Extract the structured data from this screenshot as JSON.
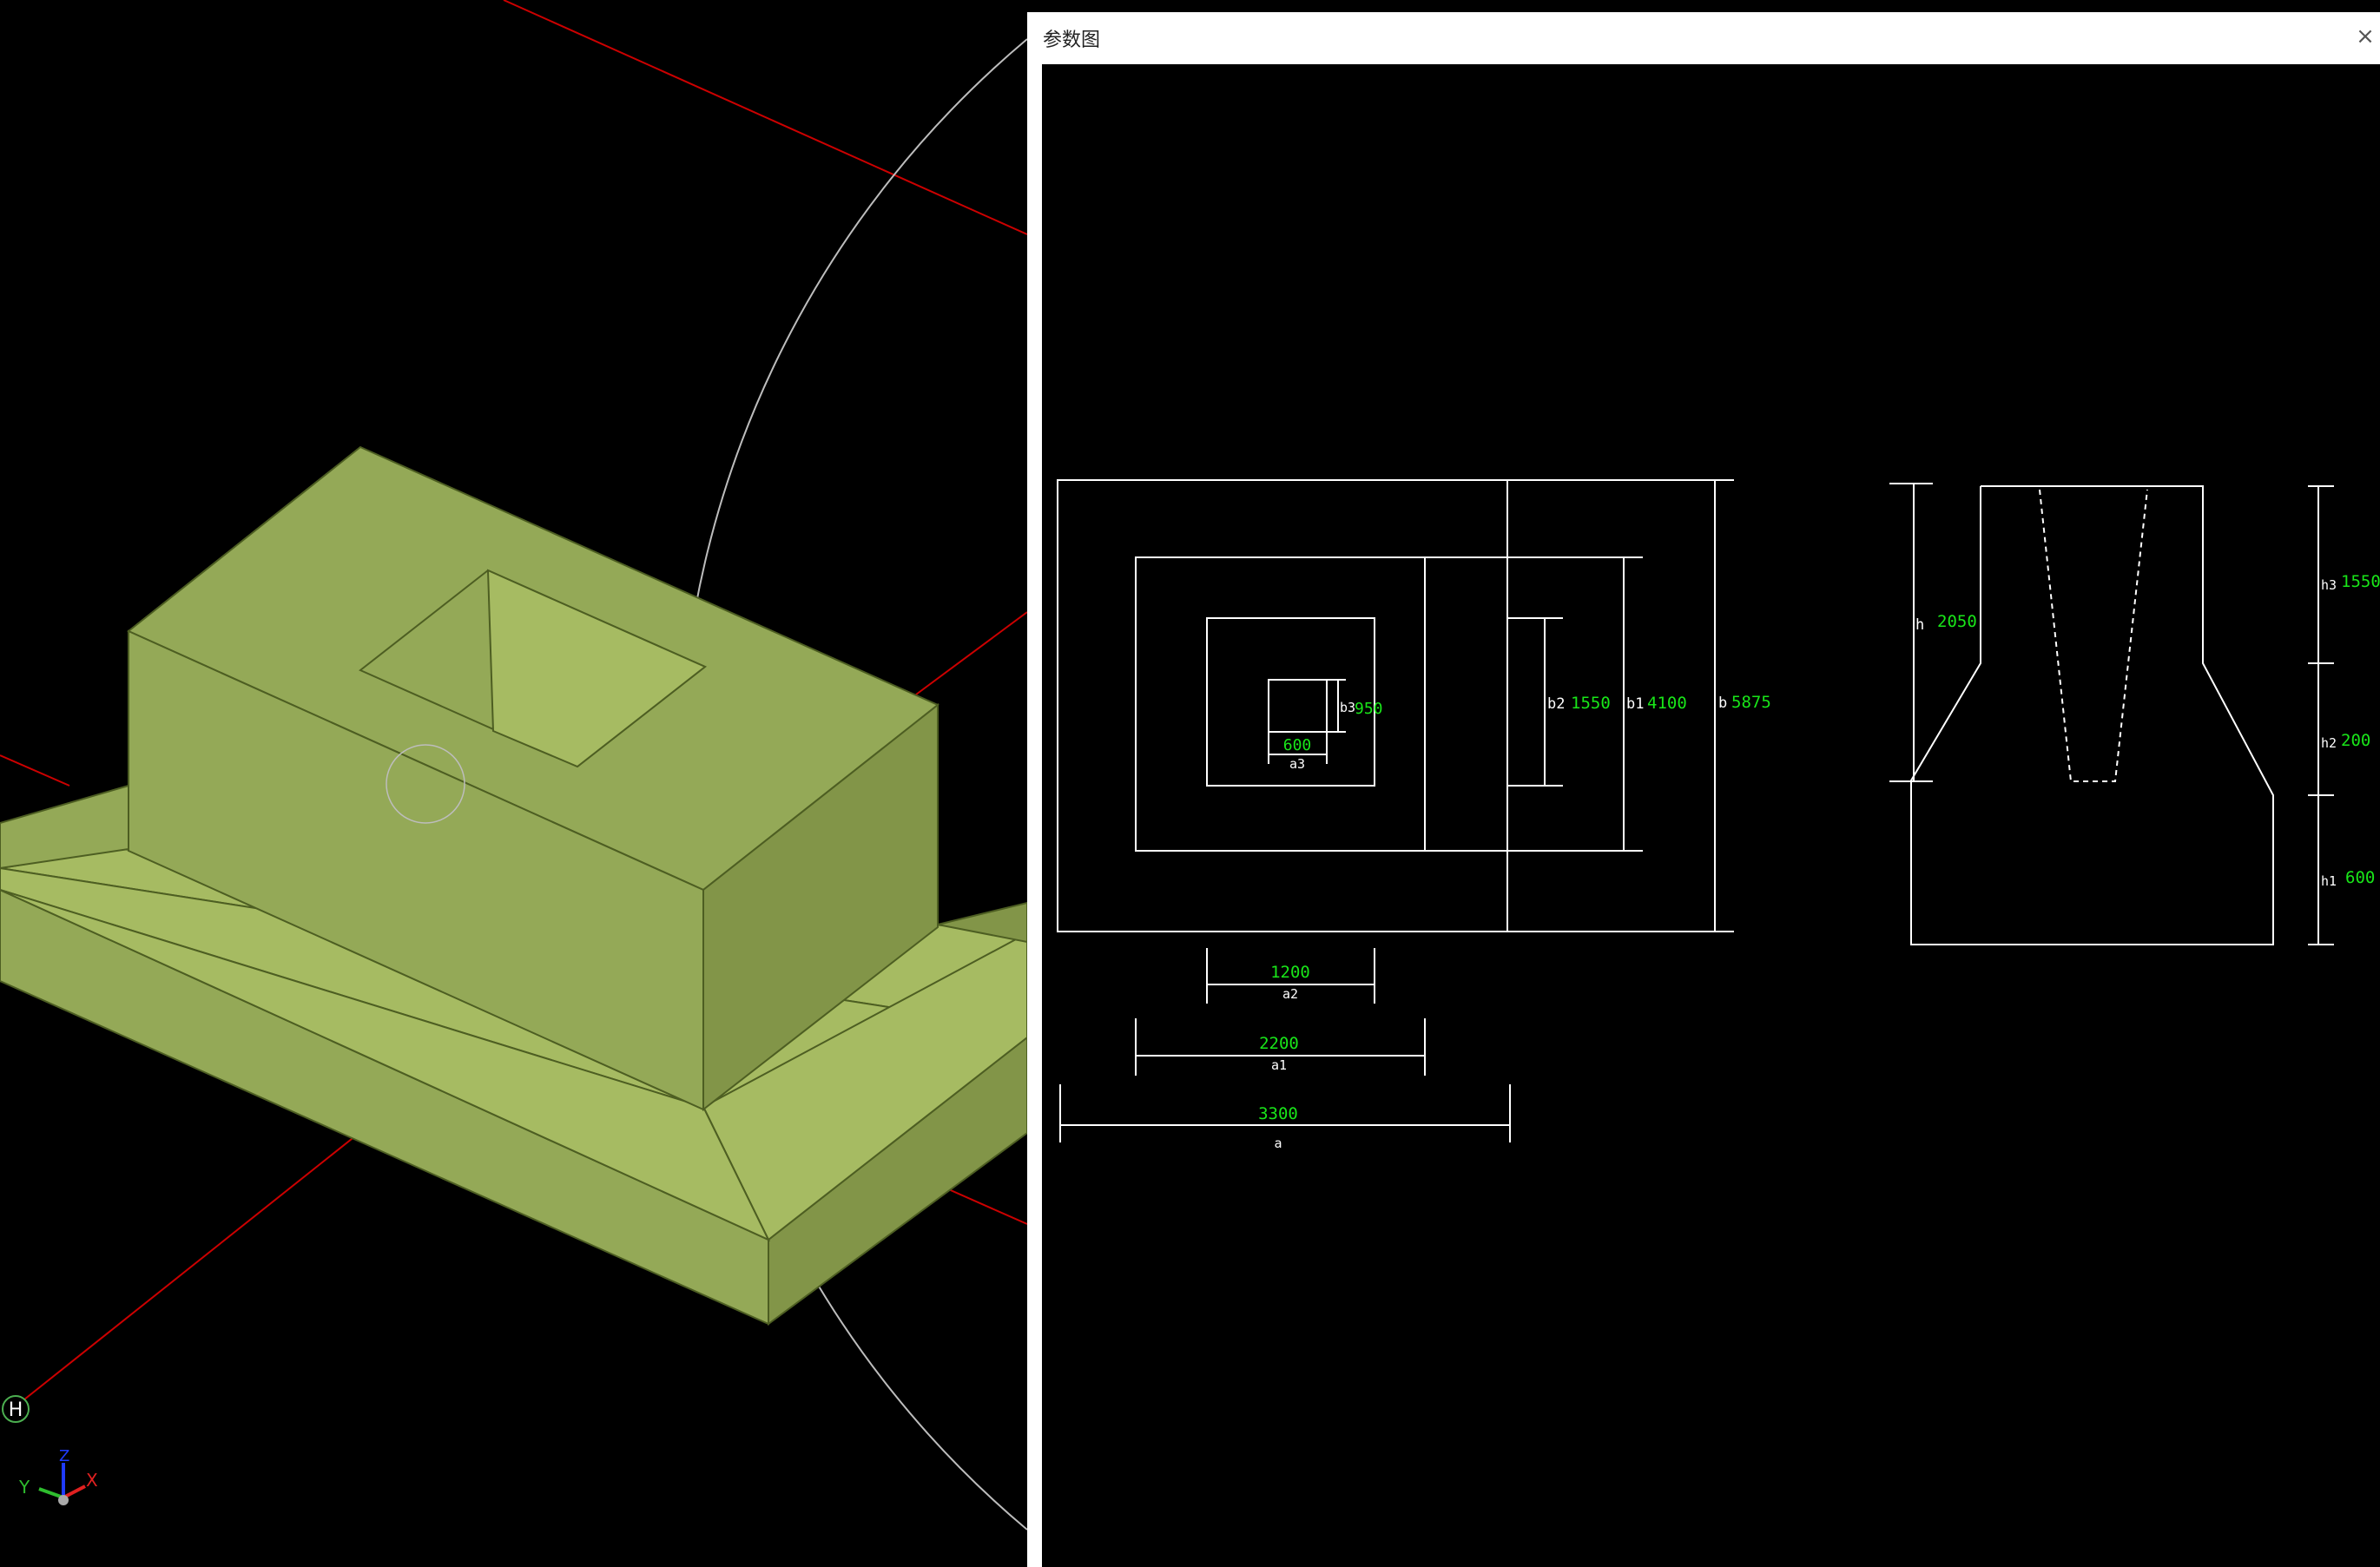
{
  "dialog": {
    "title": "参数图",
    "close_label": "×"
  },
  "viewport": {
    "marker_label": "H",
    "axis_labels": {
      "x": "X",
      "y": "Y",
      "z": "Z"
    },
    "colors": {
      "solid_light": "#a6bb62",
      "solid_mid": "#94a957",
      "solid_dark": "#829548",
      "edge": "#4d5e22",
      "axis_line": "#cc0000"
    }
  },
  "plan": {
    "a_label": "a",
    "a_value": "3300",
    "a1_label": "a1",
    "a1_value": "2200",
    "a2_label": "a2",
    "a2_value": "1200",
    "a3_label": "a3",
    "a3_value": "600",
    "b_label": "b",
    "b_value": "5875",
    "b1_label": "b1",
    "b1_value": "4100",
    "b2_label": "b2",
    "b2_value": "1550",
    "b3_label": "b3",
    "b3_value": "950"
  },
  "section": {
    "h_label": "h",
    "h_value": "2050",
    "h1_label": "h1",
    "h1_value": "600",
    "h2_label": "h2",
    "h2_value": "200",
    "h3_label": "h3",
    "h3_value": "1550"
  },
  "colors": {
    "value_text": "#19e619",
    "label_text": "#ffffff",
    "line": "#ffffff"
  }
}
